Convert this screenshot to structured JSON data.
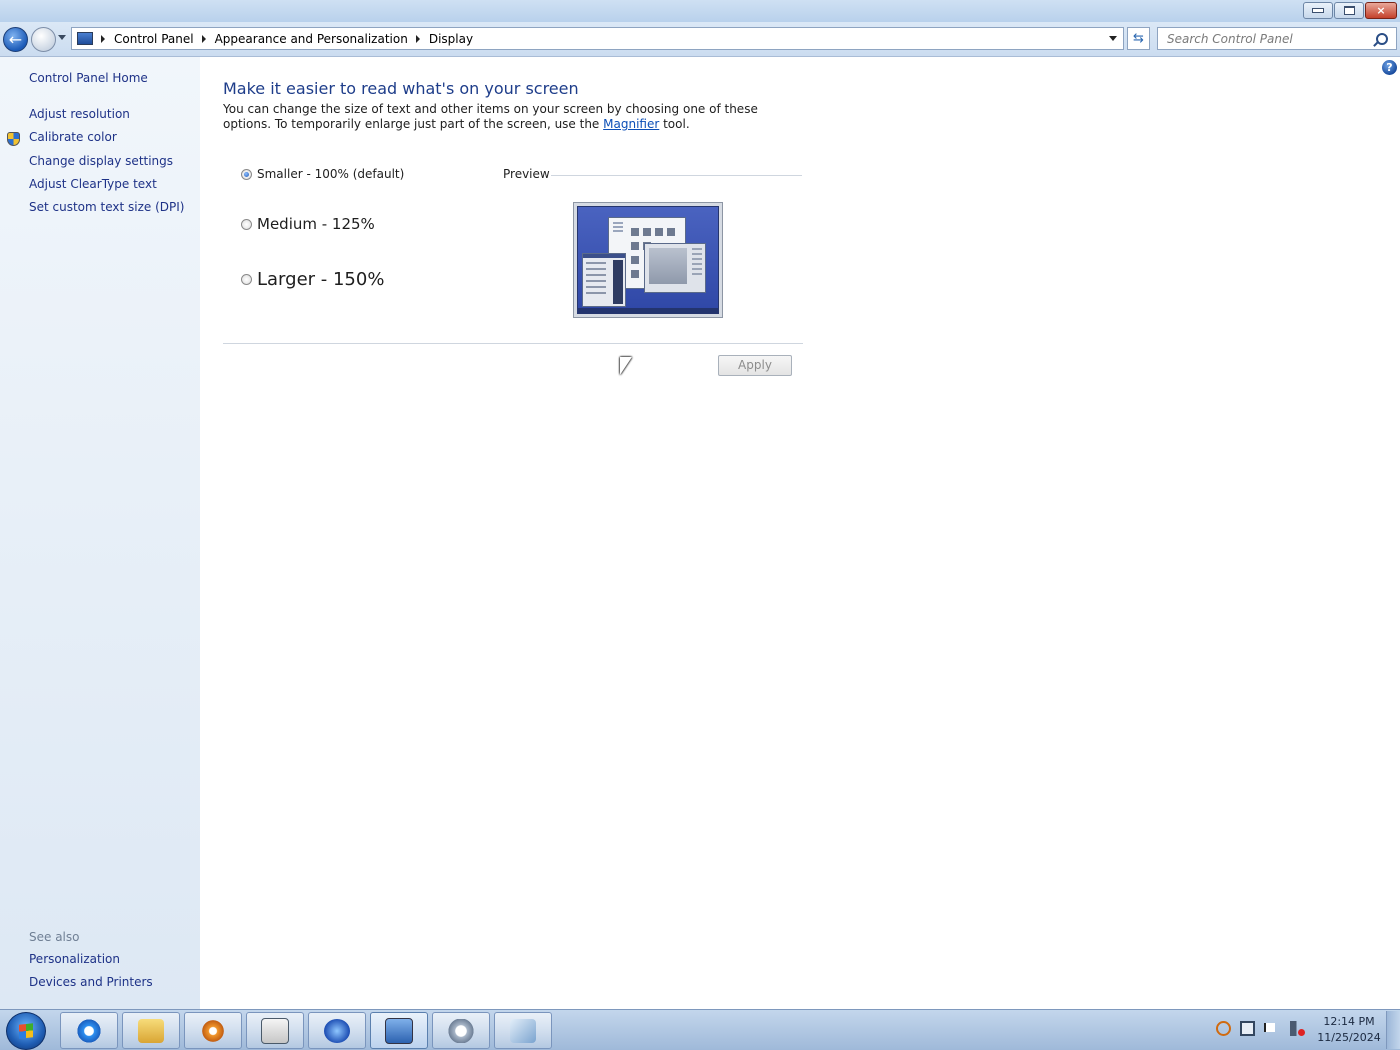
{
  "window": {
    "minimize_label": "",
    "maximize_label": "",
    "close_label": "×"
  },
  "nav": {
    "back_glyph": "←",
    "breadcrumbs": [
      "Control Panel",
      "Appearance and Personalization",
      "Display"
    ],
    "refresh_glyph": "⇆",
    "search_placeholder": "Search Control Panel"
  },
  "sidebar": {
    "home": "Control Panel Home",
    "links": [
      "Adjust resolution",
      "Calibrate color",
      "Change display settings",
      "Adjust ClearType text",
      "Set custom text size (DPI)"
    ],
    "see_also_title": "See also",
    "see_also": [
      "Personalization",
      "Devices and Printers"
    ]
  },
  "main": {
    "help_glyph": "?",
    "heading": "Make it easier to read what's on your screen",
    "desc_before": "You can change the size of text and other items on your screen by choosing one of these options. To temporarily enlarge just part of the screen, use the ",
    "desc_link": "Magnifier",
    "desc_after": " tool.",
    "options": [
      {
        "label": "Smaller - 100% (default)",
        "selected": true
      },
      {
        "label": "Medium - 125%",
        "selected": false
      },
      {
        "label": "Larger - 150%",
        "selected": false
      }
    ],
    "preview_label": "Preview",
    "apply_label": "Apply"
  },
  "taskbar": {
    "items": [
      "internet-explorer-icon",
      "file-explorer-icon",
      "media-player-icon",
      "window-app-icon",
      "browser-app-icon",
      "control-panel-icon",
      "media-center-icon",
      "display-app-icon"
    ],
    "tray": [
      "search-tray-icon",
      "network-icon",
      "action-center-flag-icon",
      "volume-muted-icon"
    ],
    "time": "12:14 PM",
    "date": "11/25/2024"
  }
}
